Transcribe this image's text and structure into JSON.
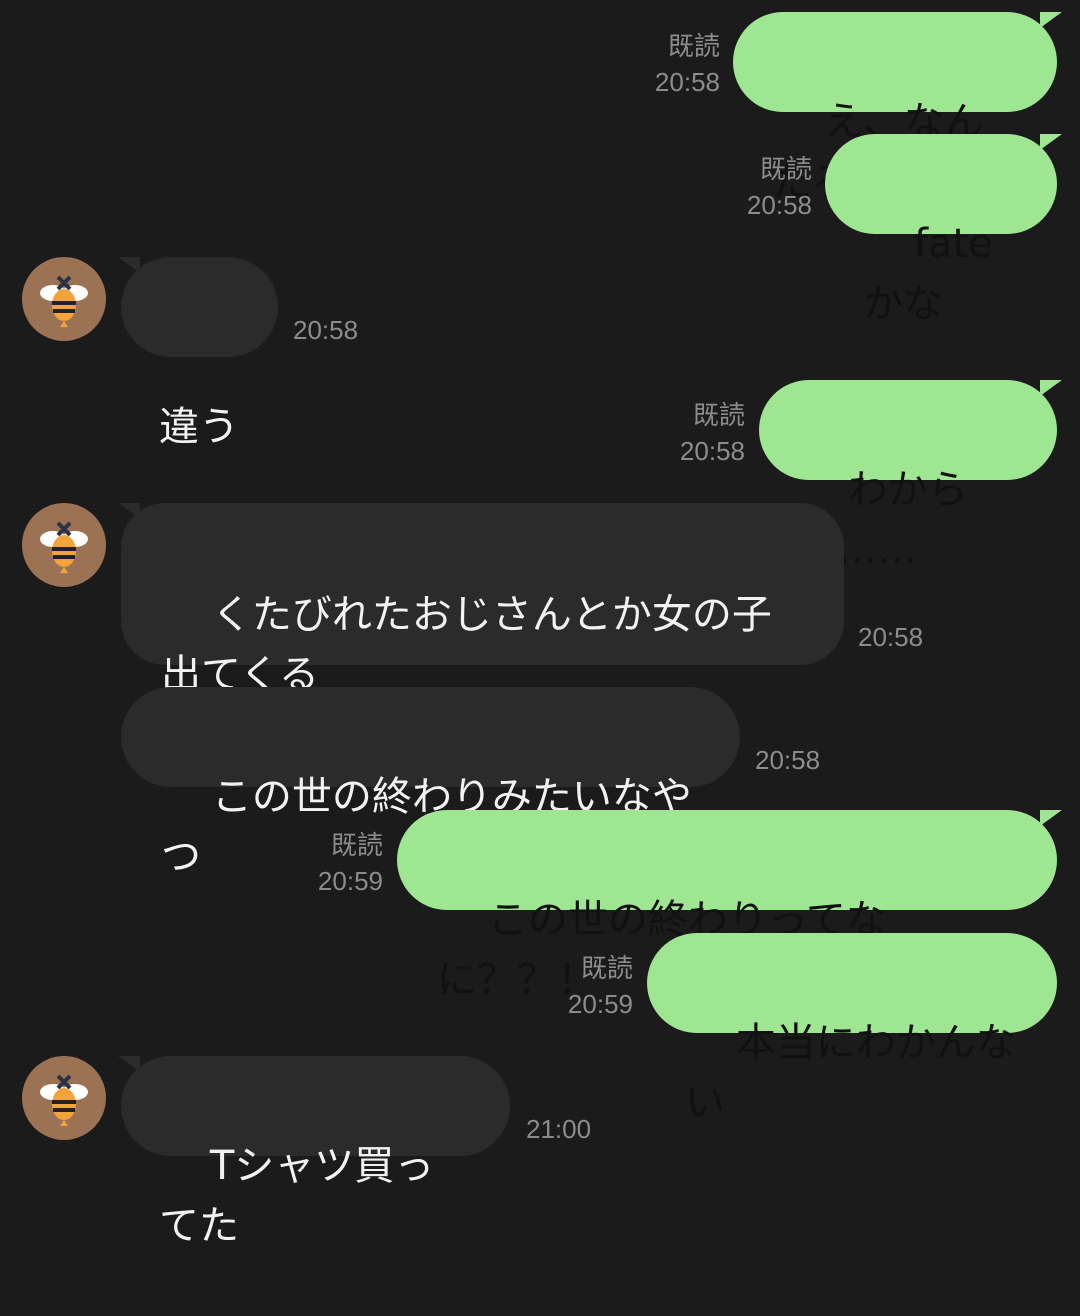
{
  "colors": {
    "background": "#1b1b1b",
    "outgoing_bubble": "#9fe693",
    "incoming_bubble": "#2b2b2b",
    "meta_text": "#8c8c8c",
    "avatar_bg": "#9b7253"
  },
  "contact": {
    "avatar_icon": "bee-icon"
  },
  "messages": [
    {
      "direction": "out",
      "text": "え、なんだろ",
      "read_label": "既読",
      "time": "20:58"
    },
    {
      "direction": "out",
      "text": "fateかな",
      "read_label": "既読",
      "time": "20:58"
    },
    {
      "direction": "in",
      "text": "違う",
      "time": "20:58"
    },
    {
      "direction": "out",
      "text": "わからｎ……",
      "read_label": "既読",
      "time": "20:58"
    },
    {
      "direction": "in",
      "text": "くたびれたおじさんとか女の子出てくる",
      "time": "20:58"
    },
    {
      "direction": "in",
      "text": "この世の終わりみたいなやつ",
      "time": "20:58"
    },
    {
      "direction": "out",
      "text": "この世の終わりってなに？？！",
      "read_label": "既読",
      "time": "20:59"
    },
    {
      "direction": "out",
      "text": "本当にわかんない",
      "read_label": "既読",
      "time": "20:59"
    },
    {
      "direction": "in",
      "text": "Tシャツ買ってた",
      "time": "21:00"
    }
  ]
}
